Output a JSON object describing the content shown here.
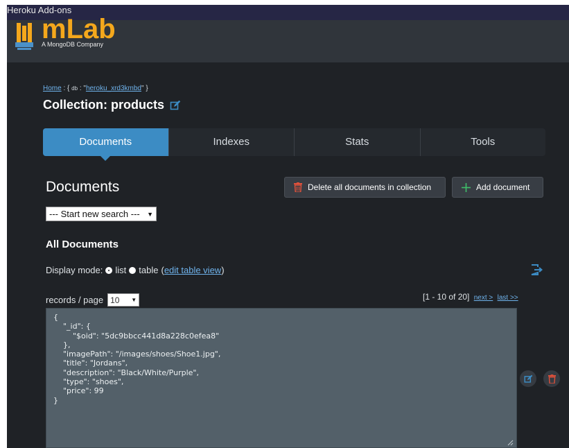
{
  "window": {
    "title": "Heroku Add-ons"
  },
  "header": {
    "logo_text": "mLab",
    "tagline": "A MongoDB Company"
  },
  "breadcrumb": {
    "home": "Home",
    "separator": " : { ",
    "db_key": "db",
    "db_sep": " : \"",
    "db_name": "heroku_xrd3kmbd",
    "closing": "\" }"
  },
  "collection": {
    "label": "Collection: products"
  },
  "tabs": [
    {
      "label": "Documents",
      "active": true
    },
    {
      "label": "Indexes",
      "active": false
    },
    {
      "label": "Stats",
      "active": false
    },
    {
      "label": "Tools",
      "active": false
    }
  ],
  "documents_section": {
    "heading": "Documents",
    "delete_all_label": "Delete all documents in collection",
    "add_document_label": "Add document",
    "search_select": "--- Start new search ---"
  },
  "all_documents": {
    "heading": "All Documents",
    "display_mode_label": "Display mode:",
    "mode_list": "list",
    "mode_table": "table",
    "edit_table_view": "edit table view",
    "open_paren": "(",
    "close_paren": ")",
    "records_label": "records / page",
    "records_value": "10",
    "range": "[1 - 10 of 20]",
    "next": "next >",
    "last": "last >>"
  },
  "document": {
    "json_text": "{\n    \"_id\": {\n        \"$oid\": \"5dc9bbcc441d8a228c0efea8\"\n    },\n    \"imagePath\": \"/images/shoes/Shoe1.jpg\",\n    \"title\": \"Jordans\",\n    \"description\": \"Black/White/Purple\",\n    \"type\": \"shoes\",\n    \"price\": 99\n}"
  },
  "colors": {
    "background": "#1f2226",
    "header": "#30353b",
    "accent_tab": "#3c8cc4",
    "logo": "#f4a81c",
    "link": "#6fb3ec",
    "danger": "#e0513b",
    "success": "#3fbf6a"
  },
  "icons": [
    "mlab-logo-icon",
    "edit-icon",
    "trash-icon",
    "plus-icon",
    "export-icon",
    "resize-grip-icon"
  ]
}
